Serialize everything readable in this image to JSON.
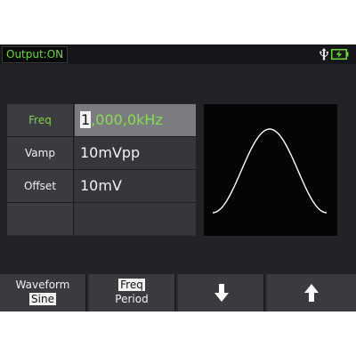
{
  "status": {
    "output_label": "Output:ON",
    "usb_icon": "usb-icon",
    "battery_icon": "battery-charging-icon",
    "colors": {
      "output_text": "#6bd836",
      "battery": "#6bd836"
    }
  },
  "params": {
    "rows": [
      {
        "label": "Freq",
        "value_cursor": "1",
        "value_rest": ",000,0kHz",
        "active": true
      },
      {
        "label": "Vamp",
        "value": "10mVpp",
        "active": false
      },
      {
        "label": "Offset",
        "value": "10mV",
        "active": false
      },
      {
        "label": "",
        "value": "",
        "active": false
      }
    ],
    "colors": {
      "active_text": "#86e04a",
      "active_value_bg": "#7b7c80"
    }
  },
  "waveform": {
    "type": "sine",
    "stroke": "#ffffff"
  },
  "softkeys": {
    "waveform": {
      "line1": "Waveform",
      "line2": "Sine"
    },
    "freq_period": {
      "line1": "Freq",
      "line2": "Period"
    },
    "down": {
      "icon": "arrow-down-icon"
    },
    "up": {
      "icon": "arrow-up-icon"
    }
  }
}
